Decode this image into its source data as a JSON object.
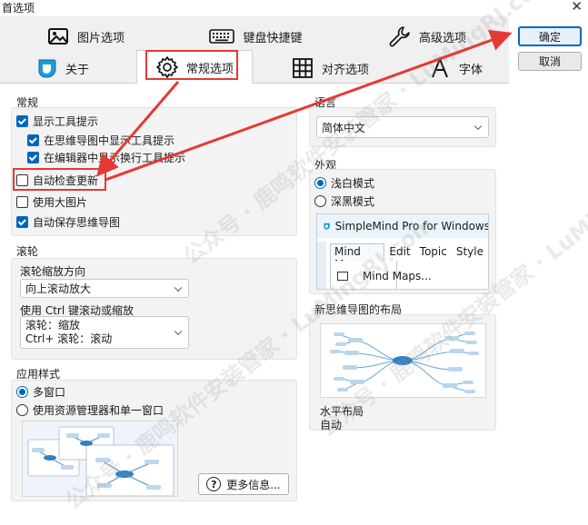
{
  "window": {
    "title": "首选项",
    "close_glyph": "✕"
  },
  "tabs": [
    {
      "label": "图片选项",
      "icon": "image-icon"
    },
    {
      "label": "键盘快捷键",
      "icon": "keyboard-icon"
    },
    {
      "label": "高级选项",
      "icon": "wrench-icon"
    },
    {
      "label": "关于",
      "icon": "simplemind-logo-icon"
    },
    {
      "label": "常规选项",
      "icon": "gear-icon",
      "active": true
    },
    {
      "label": "对齐选项",
      "icon": "grid-icon"
    },
    {
      "label": "字体",
      "icon": "font-icon"
    }
  ],
  "buttons": {
    "ok": "确定",
    "cancel": "取消"
  },
  "general": {
    "title": "常规",
    "items": [
      {
        "label": "显示工具提示",
        "checked": true
      },
      {
        "label": "在思维导图中显示工具提示",
        "checked": true
      },
      {
        "label": "在编辑器中显示换行工具提示",
        "checked": true
      },
      {
        "label": "自动检查更新",
        "checked": false
      },
      {
        "label": "使用大图片",
        "checked": false
      },
      {
        "label": "自动保存思维导图",
        "checked": true
      }
    ]
  },
  "scroll": {
    "title": "滚轮",
    "direction_label": "滚轮缩放方向",
    "direction_value": "向上滚动放大",
    "ctrl_label": "使用 Ctrl 键滚动或缩放",
    "ctrl_line1": "滚轮：缩放",
    "ctrl_line2": "Ctrl+ 滚轮：滚动"
  },
  "app_style": {
    "title": "应用样式",
    "options": [
      {
        "label": "多窗口",
        "selected": true
      },
      {
        "label": "使用资源管理器和单一窗口",
        "selected": false
      }
    ],
    "more_info": "更多信息..."
  },
  "language": {
    "title": "语言",
    "value": "简体中文"
  },
  "appearance": {
    "title": "外观",
    "options": [
      {
        "label": "浅白模式",
        "selected": true
      },
      {
        "label": "深黑模式",
        "selected": false
      }
    ],
    "preview": {
      "app_title": "SimpleMind Pro for Windows",
      "menu": [
        "Mind Map",
        "Edit",
        "Topic",
        "Style"
      ],
      "item": "Mind Maps..."
    }
  },
  "layout": {
    "title": "新思维导图的布局",
    "name": "水平布局",
    "value": "自动"
  },
  "watermark_text": "公众号 · 鹿鸣软件安装管家 · LuMingRJ.com",
  "colors": {
    "accent": "#0067c0",
    "highlight": "#e53935"
  }
}
